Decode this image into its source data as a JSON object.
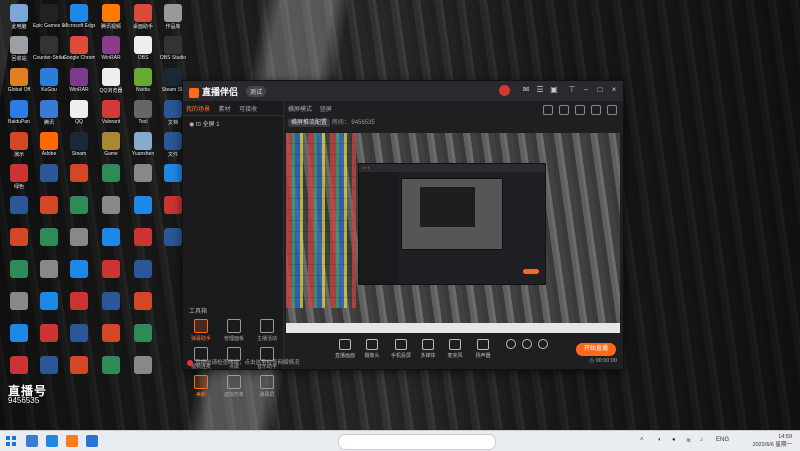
{
  "desktop": {
    "icons": [
      {
        "label": "此电脑",
        "color": "#7aa7d8"
      },
      {
        "label": "Epic Games Launcher",
        "color": "#222222"
      },
      {
        "label": "Microsoft Edge",
        "color": "#1e88e5"
      },
      {
        "label": "腾讯视频",
        "color": "#ff7a00"
      },
      {
        "label": "桌面助手",
        "color": "#d84a3a"
      },
      {
        "label": "作品库",
        "color": "#999999"
      },
      {
        "label": "回收站",
        "color": "#9aa0a6"
      },
      {
        "label": "Counter-Strike",
        "color": "#333333"
      },
      {
        "label": "Google Chrome",
        "color": "#dd4b39"
      },
      {
        "label": "WinRAR",
        "color": "#8a3c8a"
      },
      {
        "label": "OBS",
        "color": "#eeeeee"
      },
      {
        "label": "OBS Studio",
        "color": "#333333"
      },
      {
        "label": "Global Off",
        "color": "#e08020"
      },
      {
        "label": "KuGou",
        "color": "#2a7ed8"
      },
      {
        "label": "WinRAR",
        "color": "#7a3c8a"
      },
      {
        "label": "QQ浏览器",
        "color": "#eeeeee"
      },
      {
        "label": "Nvidia",
        "color": "#66aa33"
      },
      {
        "label": "Steam SE",
        "color": "#1b2838"
      },
      {
        "label": "BaiduPan",
        "color": "#2d7be5"
      },
      {
        "label": "腾讯",
        "color": "#3a7ad5"
      },
      {
        "label": "QQ",
        "color": "#eeeeee"
      },
      {
        "label": "Valorant",
        "color": "#d43a3a"
      },
      {
        "label": "Tool",
        "color": "#666666"
      },
      {
        "label": "文档",
        "color": "#2b5797"
      },
      {
        "label": "演示",
        "color": "#d24726"
      },
      {
        "label": "Adobe",
        "color": "#ff6a00"
      },
      {
        "label": "Steam",
        "color": "#1b2838"
      },
      {
        "label": "Game",
        "color": "#aa8833"
      },
      {
        "label": "Yuanshen",
        "color": "#88aacc"
      },
      {
        "label": "文件",
        "color": "#2b5797"
      },
      {
        "label": "绿色",
        "color": "#2e8b57"
      }
    ]
  },
  "watermark": {
    "logo": "直播号",
    "id": "9456535"
  },
  "app": {
    "brand": "直播伴侣",
    "badge": "测试",
    "left_tabs": [
      "我的场景",
      "素材",
      "可接收"
    ],
    "scene_label": "全屏 1",
    "section_title": "工具箱",
    "tools": [
      {
        "label": "弹幕助手",
        "hot": true
      },
      {
        "label": "管理面板",
        "hot": false
      },
      {
        "label": "主播活动",
        "hot": false
      },
      {
        "label": "视频连麦",
        "hot": false
      },
      {
        "label": "点歌",
        "hot": false
      },
      {
        "label": "音乐助手",
        "hot": false
      },
      {
        "label": "美颜",
        "hot": true
      },
      {
        "label": "虚拟形象",
        "hot": false
      },
      {
        "label": "弹幕屏",
        "hot": false
      }
    ],
    "main_tabs": [
      "横屏模式",
      "竖屏"
    ],
    "info_chip": "横屏推流配置",
    "info_room": "房间：",
    "info_id": "9456535",
    "bottom_items": [
      "直播画面",
      "摄像头",
      "手机投屏",
      "多媒体",
      "麦克风",
      "扬声器"
    ],
    "live_button": "开始直播",
    "status_left": "直播前请检查网络，点击这里检查网络情况",
    "status_right": "00:00:00"
  },
  "taskbar": {
    "tray_lang": "ENG",
    "time": "14:59",
    "date": "2022/6/6 星期一"
  }
}
